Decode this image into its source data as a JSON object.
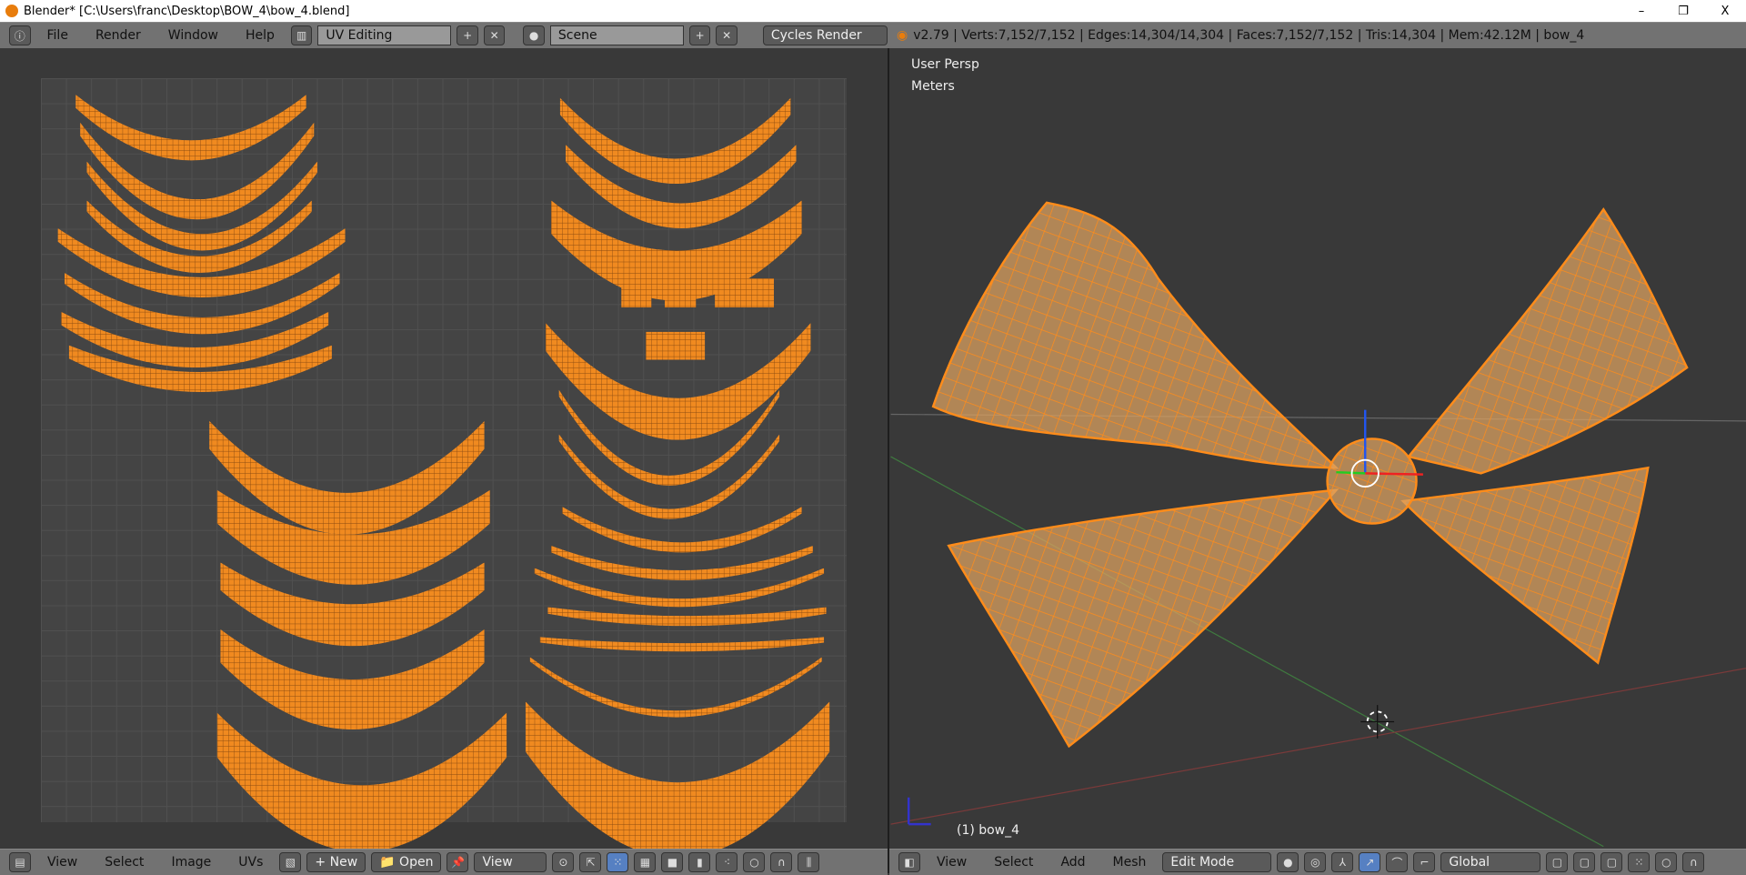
{
  "window": {
    "title": "Blender* [C:\\Users\\franc\\Desktop\\BOW_4\\bow_4.blend]",
    "minimize": "–",
    "restore": "❐",
    "close": "X"
  },
  "top_header": {
    "menus": [
      "File",
      "Render",
      "Window",
      "Help"
    ],
    "screen_layout": "UV Editing",
    "scene": "Scene",
    "render_engine": "Cycles Render",
    "stats": "v2.79 | Verts:7,152/7,152 | Edges:14,304/14,304 | Faces:7,152/7,152 | Tris:14,304 | Mem:42.12M | bow_4"
  },
  "uv_editor": {
    "menus": [
      "View",
      "Select",
      "Image",
      "UVs"
    ],
    "new_label": "New",
    "open_label": "Open",
    "view_label": "View"
  },
  "viewport": {
    "view_name": "User Persp",
    "units": "Meters",
    "object_label": "(1) bow_4",
    "menus": [
      "View",
      "Select",
      "Add",
      "Mesh"
    ],
    "mode": "Edit Mode",
    "orientation": "Global"
  },
  "colors": {
    "accent": "#f7931e",
    "selected_button": "#5680c2",
    "header": "#727272"
  }
}
